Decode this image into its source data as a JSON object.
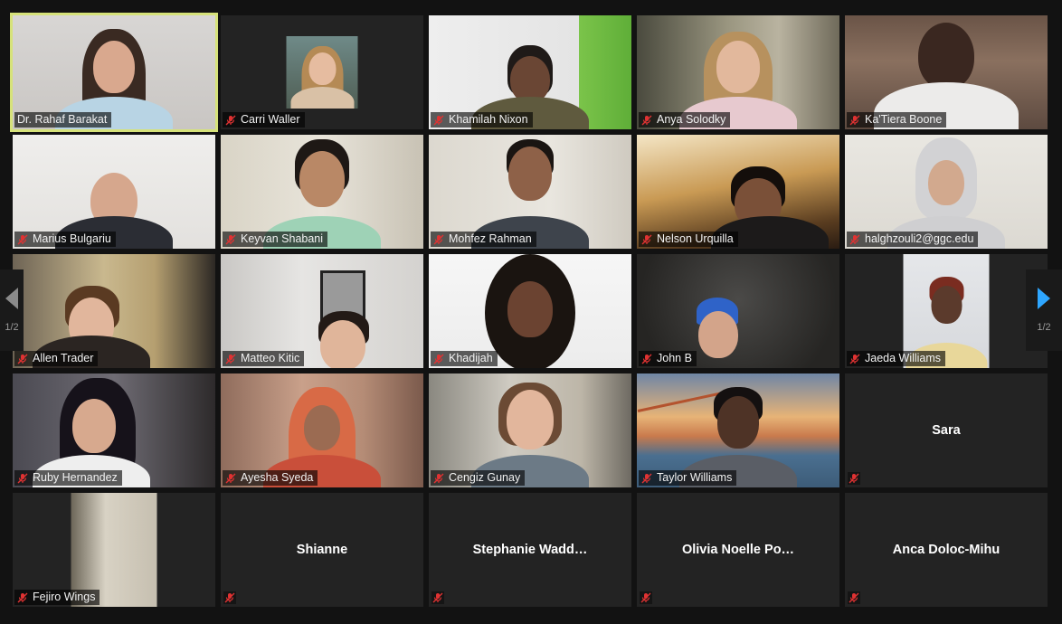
{
  "pagination": {
    "left_page": "1/2",
    "right_page": "1/2"
  },
  "colors": {
    "active_speaker_border": "#d6e27a",
    "muted_icon": "#e03232",
    "next_arrow": "#2ea6ff"
  },
  "participants": [
    {
      "name": "Dr. Rahaf Barakat",
      "video": true,
      "active": true
    },
    {
      "name": "Carri Waller",
      "video": true
    },
    {
      "name": "Khamilah Nixon",
      "video": true
    },
    {
      "name": "Anya Solodky",
      "video": true
    },
    {
      "name": "Ka'Tiera Boone",
      "video": true
    },
    {
      "name": "Marius Bulgariu",
      "video": true
    },
    {
      "name": "Keyvan Shabani",
      "video": true
    },
    {
      "name": "Mohfez Rahman",
      "video": true
    },
    {
      "name": "Nelson Urquilla",
      "video": true
    },
    {
      "name": "halghzouli2@ggc.edu",
      "video": true
    },
    {
      "name": "Allen Trader",
      "video": true
    },
    {
      "name": "Matteo Kitic",
      "video": true
    },
    {
      "name": "Khadijah",
      "video": true
    },
    {
      "name": "John B",
      "video": true
    },
    {
      "name": "Jaeda Williams",
      "video": true
    },
    {
      "name": "Ruby Hernandez",
      "video": true
    },
    {
      "name": "Ayesha Syeda",
      "video": true
    },
    {
      "name": "Cengiz Gunay",
      "video": true
    },
    {
      "name": "Taylor Williams",
      "video": true
    },
    {
      "name": "Sara",
      "video": false
    },
    {
      "name": "Fejiro Wings",
      "video": true
    },
    {
      "name": "Shianne",
      "video": false
    },
    {
      "name": "Stephanie  Wadd…",
      "video": false
    },
    {
      "name": "Olivia  Noelle  Po…",
      "video": false
    },
    {
      "name": "Anca Doloc-Mihu",
      "video": false
    }
  ]
}
